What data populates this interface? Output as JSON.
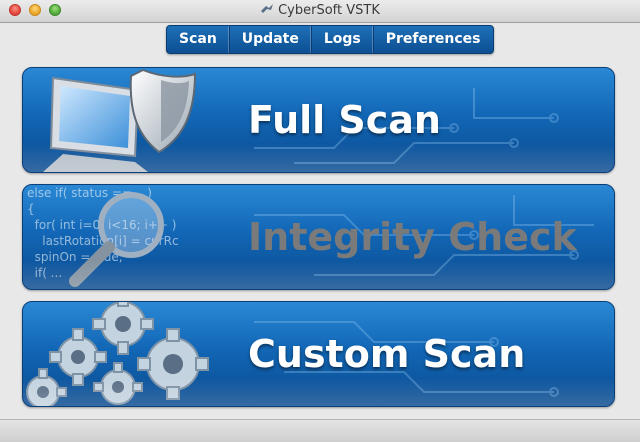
{
  "window": {
    "title": "CyberSoft VSTK"
  },
  "tabs": [
    {
      "label": "Scan"
    },
    {
      "label": "Update"
    },
    {
      "label": "Logs"
    },
    {
      "label": "Preferences"
    }
  ],
  "cards": {
    "full_scan": {
      "label": "Full Scan",
      "icon": "computer-shield-icon"
    },
    "integrity_check": {
      "label": "Integrity Check",
      "icon": "magnifier-code-icon",
      "state": "disabled",
      "code_lines": [
        "else if( status == ...)",
        "{",
        "  for( int i=0; i<16; i++ )",
        "    lastRotation[i] = curRc",
        "  spinOn = true;",
        "",
        "  if( ..."
      ]
    },
    "custom_scan": {
      "label": "Custom Scan",
      "icon": "gears-icon"
    }
  },
  "colors": {
    "accent": "#1267b6",
    "accent_dark": "#0a4a8e",
    "disabled_text": "#7a7a7a"
  }
}
